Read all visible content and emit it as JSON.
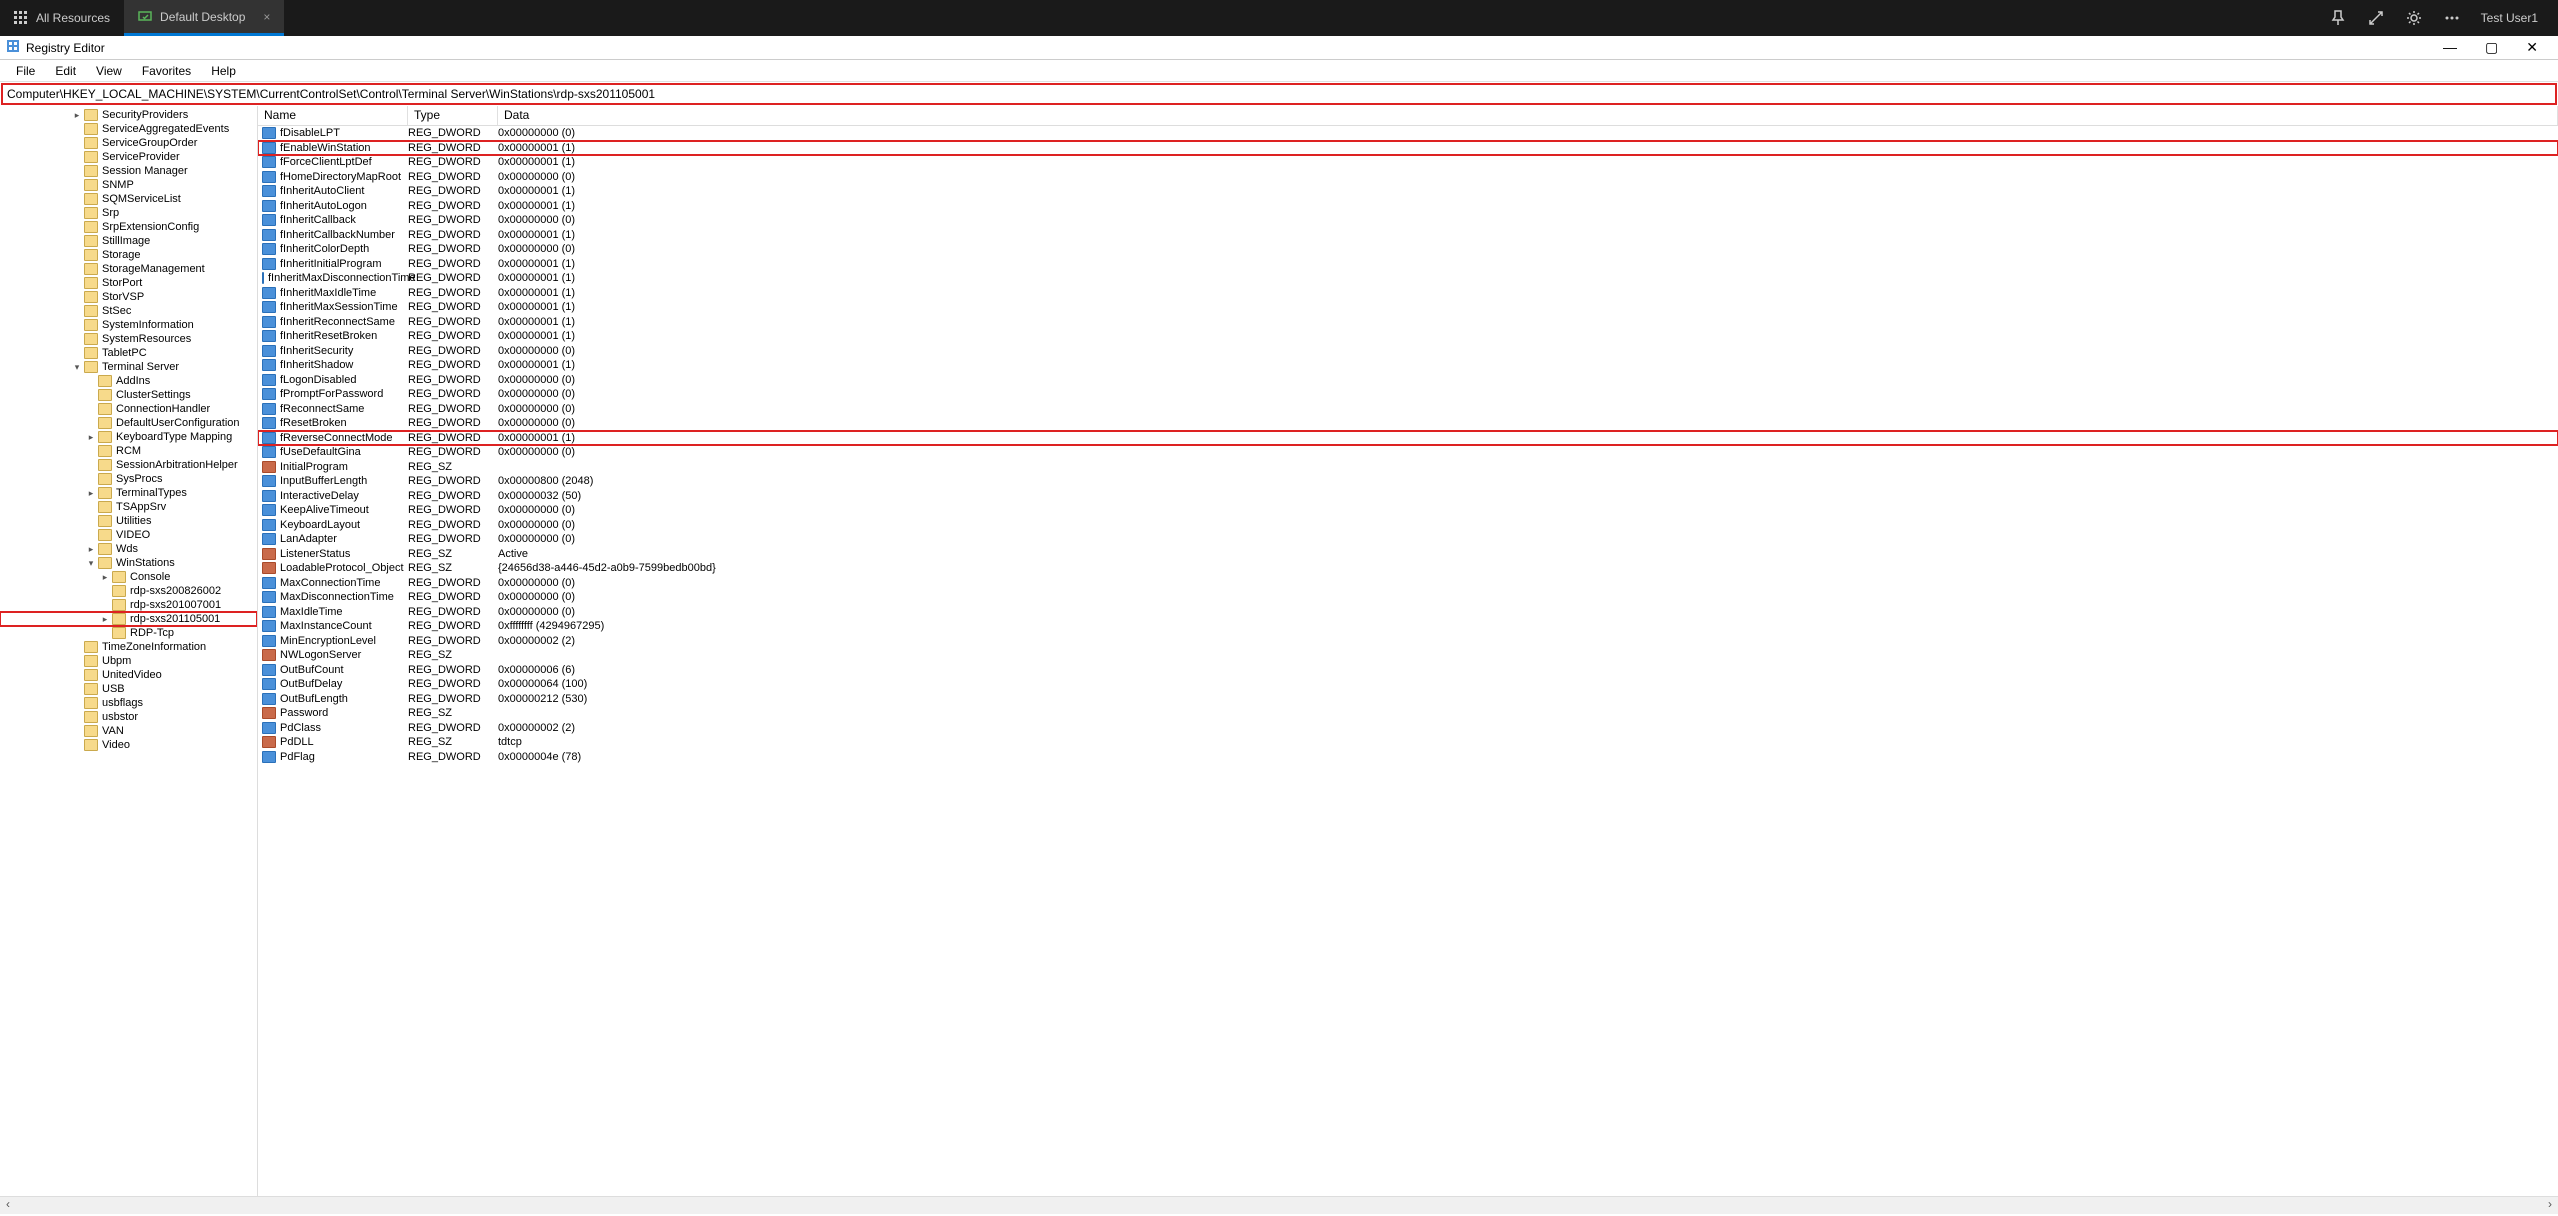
{
  "topbar": {
    "tabs": [
      {
        "label": "All Resources",
        "active": false
      },
      {
        "label": "Default Desktop",
        "active": true,
        "closable": true
      }
    ],
    "user": "Test User1"
  },
  "window": {
    "title": "Registry Editor"
  },
  "menubar": [
    "File",
    "Edit",
    "View",
    "Favorites",
    "Help"
  ],
  "addressbar": "Computer\\HKEY_LOCAL_MACHINE\\SYSTEM\\CurrentControlSet\\Control\\Terminal Server\\WinStations\\rdp-sxs201105001",
  "tree": [
    {
      "indent": 5,
      "caret": ">",
      "label": "SecurityProviders"
    },
    {
      "indent": 5,
      "caret": "",
      "label": "ServiceAggregatedEvents"
    },
    {
      "indent": 5,
      "caret": "",
      "label": "ServiceGroupOrder"
    },
    {
      "indent": 5,
      "caret": "",
      "label": "ServiceProvider"
    },
    {
      "indent": 5,
      "caret": "",
      "label": "Session Manager"
    },
    {
      "indent": 5,
      "caret": "",
      "label": "SNMP"
    },
    {
      "indent": 5,
      "caret": "",
      "label": "SQMServiceList"
    },
    {
      "indent": 5,
      "caret": "",
      "label": "Srp"
    },
    {
      "indent": 5,
      "caret": "",
      "label": "SrpExtensionConfig"
    },
    {
      "indent": 5,
      "caret": "",
      "label": "StillImage"
    },
    {
      "indent": 5,
      "caret": "",
      "label": "Storage"
    },
    {
      "indent": 5,
      "caret": "",
      "label": "StorageManagement"
    },
    {
      "indent": 5,
      "caret": "",
      "label": "StorPort"
    },
    {
      "indent": 5,
      "caret": "",
      "label": "StorVSP"
    },
    {
      "indent": 5,
      "caret": "",
      "label": "StSec"
    },
    {
      "indent": 5,
      "caret": "",
      "label": "SystemInformation"
    },
    {
      "indent": 5,
      "caret": "",
      "label": "SystemResources"
    },
    {
      "indent": 5,
      "caret": "",
      "label": "TabletPC"
    },
    {
      "indent": 5,
      "caret": "v",
      "label": "Terminal Server"
    },
    {
      "indent": 6,
      "caret": "",
      "label": "AddIns"
    },
    {
      "indent": 6,
      "caret": "",
      "label": "ClusterSettings"
    },
    {
      "indent": 6,
      "caret": "",
      "label": "ConnectionHandler"
    },
    {
      "indent": 6,
      "caret": "",
      "label": "DefaultUserConfiguration"
    },
    {
      "indent": 6,
      "caret": ">",
      "label": "KeyboardType Mapping"
    },
    {
      "indent": 6,
      "caret": "",
      "label": "RCM"
    },
    {
      "indent": 6,
      "caret": "",
      "label": "SessionArbitrationHelper"
    },
    {
      "indent": 6,
      "caret": "",
      "label": "SysProcs"
    },
    {
      "indent": 6,
      "caret": ">",
      "label": "TerminalTypes"
    },
    {
      "indent": 6,
      "caret": "",
      "label": "TSAppSrv"
    },
    {
      "indent": 6,
      "caret": "",
      "label": "Utilities"
    },
    {
      "indent": 6,
      "caret": "",
      "label": "VIDEO"
    },
    {
      "indent": 6,
      "caret": ">",
      "label": "Wds"
    },
    {
      "indent": 6,
      "caret": "v",
      "label": "WinStations"
    },
    {
      "indent": 7,
      "caret": ">",
      "label": "Console"
    },
    {
      "indent": 7,
      "caret": "",
      "label": "rdp-sxs200826002"
    },
    {
      "indent": 7,
      "caret": "",
      "label": "rdp-sxs201007001"
    },
    {
      "indent": 7,
      "caret": ">",
      "label": "rdp-sxs201105001",
      "highlighted": true
    },
    {
      "indent": 7,
      "caret": "",
      "label": "RDP-Tcp"
    },
    {
      "indent": 5,
      "caret": "",
      "label": "TimeZoneInformation"
    },
    {
      "indent": 5,
      "caret": "",
      "label": "Ubpm"
    },
    {
      "indent": 5,
      "caret": "",
      "label": "UnitedVideo"
    },
    {
      "indent": 5,
      "caret": "",
      "label": "USB"
    },
    {
      "indent": 5,
      "caret": "",
      "label": "usbflags"
    },
    {
      "indent": 5,
      "caret": "",
      "label": "usbstor"
    },
    {
      "indent": 5,
      "caret": "",
      "label": "VAN"
    },
    {
      "indent": 5,
      "caret": "",
      "label": "Video"
    }
  ],
  "columns": {
    "name": "Name",
    "type": "Type",
    "data": "Data"
  },
  "values": [
    {
      "icon": "dw",
      "name": "fDisableLPT",
      "type": "REG_DWORD",
      "data": "0x00000000 (0)"
    },
    {
      "icon": "dw",
      "name": "fEnableWinStation",
      "type": "REG_DWORD",
      "data": "0x00000001 (1)",
      "highlighted": true
    },
    {
      "icon": "dw",
      "name": "fForceClientLptDef",
      "type": "REG_DWORD",
      "data": "0x00000001 (1)"
    },
    {
      "icon": "dw",
      "name": "fHomeDirectoryMapRoot",
      "type": "REG_DWORD",
      "data": "0x00000000 (0)"
    },
    {
      "icon": "dw",
      "name": "fInheritAutoClient",
      "type": "REG_DWORD",
      "data": "0x00000001 (1)"
    },
    {
      "icon": "dw",
      "name": "fInheritAutoLogon",
      "type": "REG_DWORD",
      "data": "0x00000001 (1)"
    },
    {
      "icon": "dw",
      "name": "fInheritCallback",
      "type": "REG_DWORD",
      "data": "0x00000000 (0)"
    },
    {
      "icon": "dw",
      "name": "fInheritCallbackNumber",
      "type": "REG_DWORD",
      "data": "0x00000001 (1)"
    },
    {
      "icon": "dw",
      "name": "fInheritColorDepth",
      "type": "REG_DWORD",
      "data": "0x00000000 (0)"
    },
    {
      "icon": "dw",
      "name": "fInheritInitialProgram",
      "type": "REG_DWORD",
      "data": "0x00000001 (1)"
    },
    {
      "icon": "dw",
      "name": "fInheritMaxDisconnectionTime",
      "type": "REG_DWORD",
      "data": "0x00000001 (1)"
    },
    {
      "icon": "dw",
      "name": "fInheritMaxIdleTime",
      "type": "REG_DWORD",
      "data": "0x00000001 (1)"
    },
    {
      "icon": "dw",
      "name": "fInheritMaxSessionTime",
      "type": "REG_DWORD",
      "data": "0x00000001 (1)"
    },
    {
      "icon": "dw",
      "name": "fInheritReconnectSame",
      "type": "REG_DWORD",
      "data": "0x00000001 (1)"
    },
    {
      "icon": "dw",
      "name": "fInheritResetBroken",
      "type": "REG_DWORD",
      "data": "0x00000001 (1)"
    },
    {
      "icon": "dw",
      "name": "fInheritSecurity",
      "type": "REG_DWORD",
      "data": "0x00000000 (0)"
    },
    {
      "icon": "dw",
      "name": "fInheritShadow",
      "type": "REG_DWORD",
      "data": "0x00000001 (1)"
    },
    {
      "icon": "dw",
      "name": "fLogonDisabled",
      "type": "REG_DWORD",
      "data": "0x00000000 (0)"
    },
    {
      "icon": "dw",
      "name": "fPromptForPassword",
      "type": "REG_DWORD",
      "data": "0x00000000 (0)"
    },
    {
      "icon": "dw",
      "name": "fReconnectSame",
      "type": "REG_DWORD",
      "data": "0x00000000 (0)"
    },
    {
      "icon": "dw",
      "name": "fResetBroken",
      "type": "REG_DWORD",
      "data": "0x00000000 (0)"
    },
    {
      "icon": "dw",
      "name": "fReverseConnectMode",
      "type": "REG_DWORD",
      "data": "0x00000001 (1)",
      "highlighted": true
    },
    {
      "icon": "dw",
      "name": "fUseDefaultGina",
      "type": "REG_DWORD",
      "data": "0x00000000 (0)"
    },
    {
      "icon": "sz",
      "name": "InitialProgram",
      "type": "REG_SZ",
      "data": ""
    },
    {
      "icon": "dw",
      "name": "InputBufferLength",
      "type": "REG_DWORD",
      "data": "0x00000800 (2048)"
    },
    {
      "icon": "dw",
      "name": "InteractiveDelay",
      "type": "REG_DWORD",
      "data": "0x00000032 (50)"
    },
    {
      "icon": "dw",
      "name": "KeepAliveTimeout",
      "type": "REG_DWORD",
      "data": "0x00000000 (0)"
    },
    {
      "icon": "dw",
      "name": "KeyboardLayout",
      "type": "REG_DWORD",
      "data": "0x00000000 (0)"
    },
    {
      "icon": "dw",
      "name": "LanAdapter",
      "type": "REG_DWORD",
      "data": "0x00000000 (0)"
    },
    {
      "icon": "sz",
      "name": "ListenerStatus",
      "type": "REG_SZ",
      "data": "Active"
    },
    {
      "icon": "sz",
      "name": "LoadableProtocol_Object",
      "type": "REG_SZ",
      "data": "{24656d38-a446-45d2-a0b9-7599bedb00bd}"
    },
    {
      "icon": "dw",
      "name": "MaxConnectionTime",
      "type": "REG_DWORD",
      "data": "0x00000000 (0)"
    },
    {
      "icon": "dw",
      "name": "MaxDisconnectionTime",
      "type": "REG_DWORD",
      "data": "0x00000000 (0)"
    },
    {
      "icon": "dw",
      "name": "MaxIdleTime",
      "type": "REG_DWORD",
      "data": "0x00000000 (0)"
    },
    {
      "icon": "dw",
      "name": "MaxInstanceCount",
      "type": "REG_DWORD",
      "data": "0xffffffff (4294967295)"
    },
    {
      "icon": "dw",
      "name": "MinEncryptionLevel",
      "type": "REG_DWORD",
      "data": "0x00000002 (2)"
    },
    {
      "icon": "sz",
      "name": "NWLogonServer",
      "type": "REG_SZ",
      "data": ""
    },
    {
      "icon": "dw",
      "name": "OutBufCount",
      "type": "REG_DWORD",
      "data": "0x00000006 (6)"
    },
    {
      "icon": "dw",
      "name": "OutBufDelay",
      "type": "REG_DWORD",
      "data": "0x00000064 (100)"
    },
    {
      "icon": "dw",
      "name": "OutBufLength",
      "type": "REG_DWORD",
      "data": "0x00000212 (530)"
    },
    {
      "icon": "sz",
      "name": "Password",
      "type": "REG_SZ",
      "data": ""
    },
    {
      "icon": "dw",
      "name": "PdClass",
      "type": "REG_DWORD",
      "data": "0x00000002 (2)"
    },
    {
      "icon": "sz",
      "name": "PdDLL",
      "type": "REG_SZ",
      "data": "tdtcp"
    },
    {
      "icon": "dw",
      "name": "PdFlag",
      "type": "REG_DWORD",
      "data": "0x0000004e (78)"
    }
  ]
}
